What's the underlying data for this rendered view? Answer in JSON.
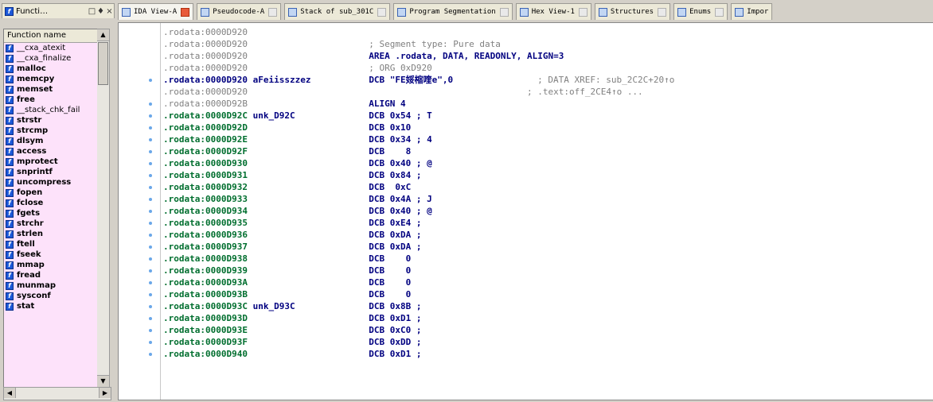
{
  "left_panel": {
    "title": "Functi…",
    "header": "Function name",
    "functions": [
      {
        "name": "__cxa_atexit",
        "bold": false
      },
      {
        "name": "__cxa_finalize",
        "bold": false
      },
      {
        "name": "malloc",
        "bold": true
      },
      {
        "name": "memcpy",
        "bold": true
      },
      {
        "name": "memset",
        "bold": true
      },
      {
        "name": "free",
        "bold": true
      },
      {
        "name": "__stack_chk_fail",
        "bold": false
      },
      {
        "name": "strstr",
        "bold": true
      },
      {
        "name": "strcmp",
        "bold": true
      },
      {
        "name": "dlsym",
        "bold": true
      },
      {
        "name": "access",
        "bold": true
      },
      {
        "name": "mprotect",
        "bold": true
      },
      {
        "name": "snprintf",
        "bold": true
      },
      {
        "name": "uncompress",
        "bold": true
      },
      {
        "name": "fopen",
        "bold": true
      },
      {
        "name": "fclose",
        "bold": true
      },
      {
        "name": "fgets",
        "bold": true
      },
      {
        "name": "strchr",
        "bold": true
      },
      {
        "name": "strlen",
        "bold": true
      },
      {
        "name": "ftell",
        "bold": true
      },
      {
        "name": "fseek",
        "bold": true
      },
      {
        "name": "mmap",
        "bold": true
      },
      {
        "name": "fread",
        "bold": true
      },
      {
        "name": "munmap",
        "bold": true
      },
      {
        "name": "sysconf",
        "bold": true
      },
      {
        "name": "stat",
        "bold": true
      }
    ]
  },
  "tabs": [
    {
      "label": "IDA View-A",
      "active": true
    },
    {
      "label": "Pseudocode-A",
      "active": false
    },
    {
      "label": "Stack of sub_301C",
      "active": false
    },
    {
      "label": "Program Segmentation",
      "active": false
    },
    {
      "label": "Hex View-1",
      "active": false
    },
    {
      "label": "Structures",
      "active": false
    },
    {
      "label": "Enums",
      "active": false
    },
    {
      "label": "Impor",
      "active": false
    }
  ],
  "disasm": [
    {
      "addr": ".rodata:0000D920",
      "label": "",
      "instr": "",
      "args": "",
      "comment": "",
      "style": "gray",
      "dot": false
    },
    {
      "addr": ".rodata:0000D920",
      "label": "",
      "instr": "; Segment type: Pure data",
      "args": "",
      "comment": "",
      "style": "gray",
      "dot": false
    },
    {
      "addr": ".rodata:0000D920",
      "label": "",
      "instr": "AREA .rodata, DATA, READONLY, ALIGN=3",
      "args": "",
      "comment": "",
      "style": "gray",
      "dot": false
    },
    {
      "addr": ".rodata:0000D920",
      "label": "",
      "instr": "; ORG 0xD920",
      "args": "",
      "comment": "",
      "style": "gray",
      "dot": false
    },
    {
      "addr": ".rodata:0000D920",
      "label": "aFeiisszzez",
      "instr": "DCB \"FE娞樎喹e\",0",
      "args": "",
      "comment": "; DATA XREF: sub_2C2C+20↑o",
      "style": "bold",
      "dot": true
    },
    {
      "addr": ".rodata:0000D920",
      "label": "",
      "instr": "",
      "args": "",
      "comment": "; .text:off_2CE4↑o ...",
      "style": "gray",
      "dot": false
    },
    {
      "addr": ".rodata:0000D92B",
      "label": "",
      "instr": "ALIGN 4",
      "args": "",
      "comment": "",
      "style": "gray",
      "dot": true
    },
    {
      "addr": ".rodata:0000D92C",
      "label": "unk_D92C",
      "instr": "DCB 0x54 ; T",
      "args": "",
      "comment": "",
      "style": "green",
      "dot": true
    },
    {
      "addr": ".rodata:0000D92D",
      "label": "",
      "instr": "DCB 0x10",
      "args": "",
      "comment": "",
      "style": "green",
      "dot": true
    },
    {
      "addr": ".rodata:0000D92E",
      "label": "",
      "instr": "DCB 0x34 ; 4",
      "args": "",
      "comment": "",
      "style": "green",
      "dot": true
    },
    {
      "addr": ".rodata:0000D92F",
      "label": "",
      "instr": "DCB    8",
      "args": "",
      "comment": "",
      "style": "green",
      "dot": true
    },
    {
      "addr": ".rodata:0000D930",
      "label": "",
      "instr": "DCB 0x40 ; @",
      "args": "",
      "comment": "",
      "style": "green",
      "dot": true
    },
    {
      "addr": ".rodata:0000D931",
      "label": "",
      "instr": "DCB 0x84 ;",
      "args": "",
      "comment": "",
      "style": "green",
      "dot": true
    },
    {
      "addr": ".rodata:0000D932",
      "label": "",
      "instr": "DCB  0xC",
      "args": "",
      "comment": "",
      "style": "green",
      "dot": true
    },
    {
      "addr": ".rodata:0000D933",
      "label": "",
      "instr": "DCB 0x4A ; J",
      "args": "",
      "comment": "",
      "style": "green",
      "dot": true
    },
    {
      "addr": ".rodata:0000D934",
      "label": "",
      "instr": "DCB 0x40 ; @",
      "args": "",
      "comment": "",
      "style": "green",
      "dot": true
    },
    {
      "addr": ".rodata:0000D935",
      "label": "",
      "instr": "DCB 0xE4 ;",
      "args": "",
      "comment": "",
      "style": "green",
      "dot": true
    },
    {
      "addr": ".rodata:0000D936",
      "label": "",
      "instr": "DCB 0xDA ;",
      "args": "",
      "comment": "",
      "style": "green",
      "dot": true
    },
    {
      "addr": ".rodata:0000D937",
      "label": "",
      "instr": "DCB 0xDA ;",
      "args": "",
      "comment": "",
      "style": "green",
      "dot": true
    },
    {
      "addr": ".rodata:0000D938",
      "label": "",
      "instr": "DCB    0",
      "args": "",
      "comment": "",
      "style": "green",
      "dot": true
    },
    {
      "addr": ".rodata:0000D939",
      "label": "",
      "instr": "DCB    0",
      "args": "",
      "comment": "",
      "style": "green",
      "dot": true
    },
    {
      "addr": ".rodata:0000D93A",
      "label": "",
      "instr": "DCB    0",
      "args": "",
      "comment": "",
      "style": "green",
      "dot": true
    },
    {
      "addr": ".rodata:0000D93B",
      "label": "",
      "instr": "DCB    0",
      "args": "",
      "comment": "",
      "style": "green",
      "dot": true
    },
    {
      "addr": ".rodata:0000D93C",
      "label": "unk_D93C",
      "instr": "DCB 0x8B ;",
      "args": "",
      "comment": "",
      "style": "green",
      "dot": true
    },
    {
      "addr": ".rodata:0000D93D",
      "label": "",
      "instr": "DCB 0xD1 ;",
      "args": "",
      "comment": "",
      "style": "green",
      "dot": true
    },
    {
      "addr": ".rodata:0000D93E",
      "label": "",
      "instr": "DCB 0xC0 ;",
      "args": "",
      "comment": "",
      "style": "green",
      "dot": true
    },
    {
      "addr": ".rodata:0000D93F",
      "label": "",
      "instr": "DCB 0xDD ;",
      "args": "",
      "comment": "",
      "style": "green",
      "dot": true
    },
    {
      "addr": ".rodata:0000D940",
      "label": "",
      "instr": "DCB 0xD1 ;",
      "args": "",
      "comment": "",
      "style": "green",
      "dot": true
    }
  ]
}
